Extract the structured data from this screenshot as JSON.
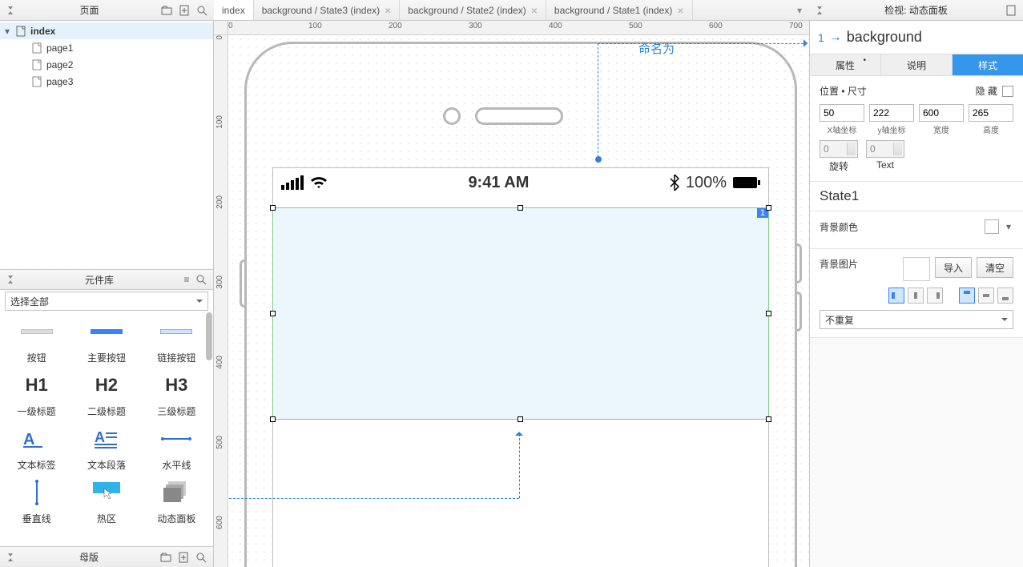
{
  "pagesPanel": {
    "title": "页面"
  },
  "pageTree": {
    "root": "index",
    "children": [
      "page1",
      "page2",
      "page3"
    ]
  },
  "tabs": [
    {
      "label": "index",
      "active": true,
      "closable": false
    },
    {
      "label": "background / State3 (index)",
      "active": false,
      "closable": true
    },
    {
      "label": "background / State2 (index)",
      "active": false,
      "closable": true
    },
    {
      "label": "background / State1 (index)",
      "active": false,
      "closable": true
    }
  ],
  "inspectorHeader": "检视: 动态面板",
  "rulerH": {
    "0": "0",
    "100": "100",
    "200": "200",
    "300": "300",
    "400": "400",
    "500": "500",
    "600": "600",
    "700": "700"
  },
  "rulerV": {
    "0": "0",
    "100": "100",
    "200": "200",
    "300": "300",
    "400": "400",
    "500": "500",
    "600": "600"
  },
  "statusBar": {
    "time": "9:41 AM",
    "battery": "100%"
  },
  "selectionBadge": "1",
  "callout1": "命名为",
  "libPanel": {
    "title": "元件库",
    "selectLabel": "选择全部"
  },
  "widgets": [
    {
      "id": "button",
      "label": "按钮"
    },
    {
      "id": "primary-button",
      "label": "主要按钮"
    },
    {
      "id": "link-button",
      "label": "链接按钮"
    },
    {
      "id": "h1",
      "label": "一级标题",
      "thumb": "H1"
    },
    {
      "id": "h2",
      "label": "二级标题",
      "thumb": "H2"
    },
    {
      "id": "h3",
      "label": "三级标题",
      "thumb": "H3"
    },
    {
      "id": "text-label",
      "label": "文本标签"
    },
    {
      "id": "paragraph",
      "label": "文本段落"
    },
    {
      "id": "hr",
      "label": "水平线"
    },
    {
      "id": "vr",
      "label": "垂直线"
    },
    {
      "id": "hotspot",
      "label": "热区"
    },
    {
      "id": "dynamic-panel",
      "label": "动态面板"
    }
  ],
  "mastersPanel": "母版",
  "inspector": {
    "name": "background",
    "nameIndex": "1",
    "tabs": {
      "props": "属性",
      "notes": "说明",
      "style": "样式"
    },
    "posSize": "位置 • 尺寸",
    "hide": "隐 藏",
    "x": "50",
    "xCap": "X轴坐标",
    "y": "222",
    "yCap": "y轴坐标",
    "w": "600",
    "wCap": "宽度",
    "h": "265",
    "hCap": "高度",
    "aspect": "⫘",
    "rot": "0",
    "rotCap": "旋转",
    "textRot": "0",
    "textCap": "Text",
    "stateName": "State1",
    "bgColor": "背景颜色",
    "bgImage": "背景图片",
    "importBtn": "导入",
    "clearBtn": "清空",
    "repeat": "不重复"
  }
}
